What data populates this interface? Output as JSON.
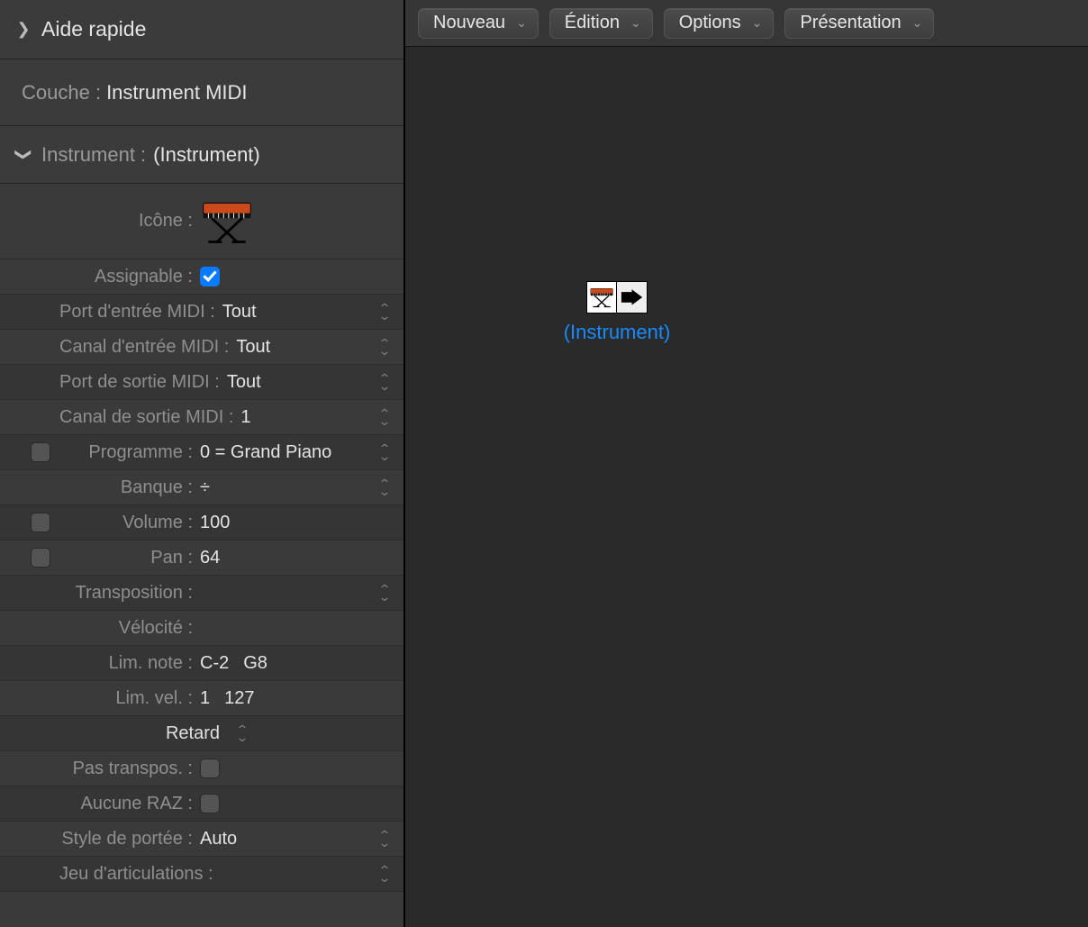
{
  "sidebar": {
    "quick_help": "Aide rapide",
    "layer_label": "Couche :",
    "layer_value": "Instrument MIDI",
    "instrument_label": "Instrument :",
    "instrument_value": "(Instrument)",
    "props": {
      "icon_label": "Icône :",
      "assignable_label": "Assignable :",
      "assignable_checked": true,
      "midi_in_port_label": "Port d'entrée MIDI :",
      "midi_in_port_value": "Tout",
      "midi_in_chan_label": "Canal d'entrée MIDI :",
      "midi_in_chan_value": "Tout",
      "midi_out_port_label": "Port de sortie MIDI :",
      "midi_out_port_value": "Tout",
      "midi_out_chan_label": "Canal de sortie MIDI :",
      "midi_out_chan_value": "1",
      "program_label": "Programme :",
      "program_value": "0 = Grand Piano",
      "bank_label": "Banque :",
      "bank_value": "÷",
      "volume_label": "Volume :",
      "volume_value": "100",
      "pan_label": "Pan :",
      "pan_value": "64",
      "transpose_label": "Transposition :",
      "transpose_value": "",
      "velocity_label": "Vélocité :",
      "velocity_value": "",
      "note_lim_label": "Lim. note :",
      "note_lim_low": "C-2",
      "note_lim_high": "G8",
      "vel_lim_label": "Lim. vel. :",
      "vel_lim_low": "1",
      "vel_lim_high": "127",
      "delay_label": "Retard",
      "no_transpose_label": "Pas transpos. :",
      "no_reset_label": "Aucune RAZ :",
      "staff_style_label": "Style de portée :",
      "staff_style_value": "Auto",
      "artic_set_label": "Jeu d'articulations :",
      "artic_set_value": ""
    }
  },
  "toolbar": {
    "new_label": "Nouveau",
    "edit_label": "Édition",
    "options_label": "Options",
    "view_label": "Présentation"
  },
  "canvas": {
    "node_label": "(Instrument)"
  }
}
